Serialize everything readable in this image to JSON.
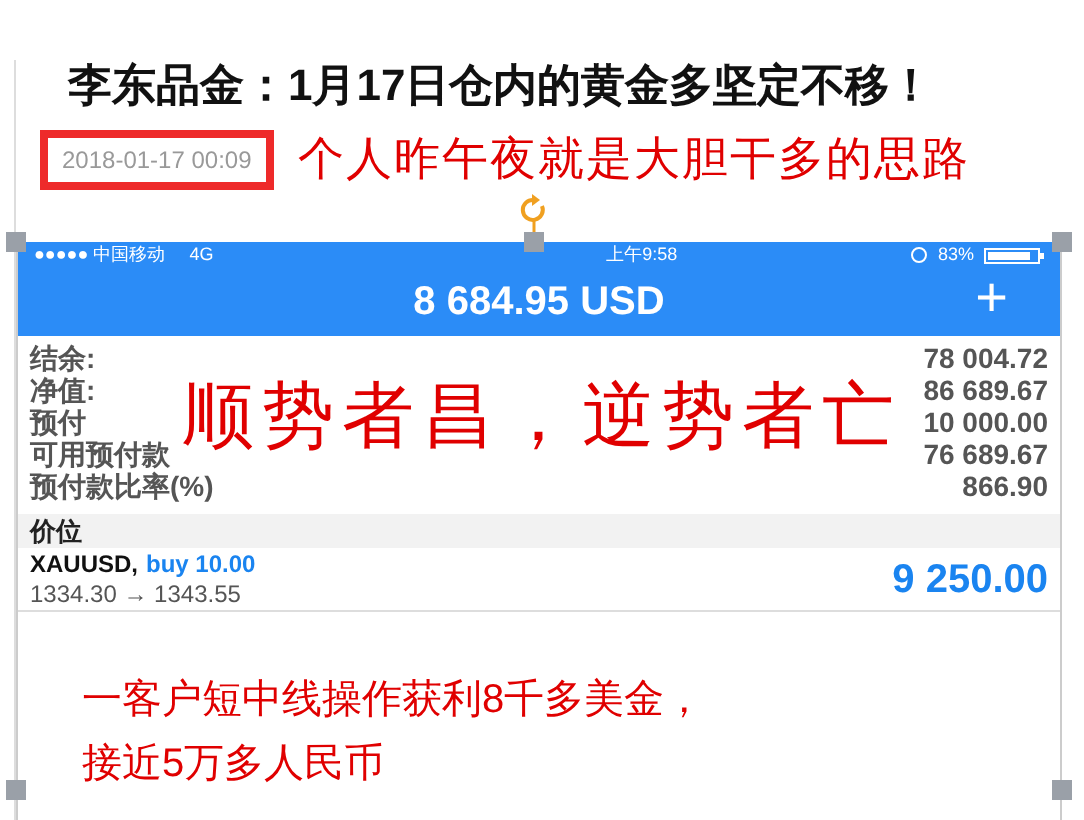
{
  "article": {
    "title": "李东品金：1月17日仓内的黄金多坚定不移！",
    "date": "2018-01-17 00:09",
    "note": "个人昨午夜就是大胆干多的思路"
  },
  "screenshot": {
    "status_bar": {
      "carrier": "●●●●● 中国移动",
      "network": "4G",
      "time": "上午9:58",
      "battery": "83%"
    },
    "header": {
      "balance": "8 684.95 USD",
      "add": "+"
    },
    "account_rows": [
      {
        "label": "结余:",
        "value": "78 004.72"
      },
      {
        "label": "净值:",
        "value": "86 689.67"
      },
      {
        "label": "预付",
        "value": "10 000.00"
      },
      {
        "label": "可用预付款",
        "value": "76 689.67"
      },
      {
        "label": "预付款比率(%)",
        "value": "866.90"
      }
    ],
    "section": "价位",
    "position": {
      "symbol": "XAUUSD,",
      "order": "buy 10.00",
      "prices": "1334.30 → 1343.55",
      "profit": "9 250.00"
    },
    "overlay": "顺势者昌，逆势者亡",
    "caption": [
      "一客户短中线操作获利8千多美金，",
      "接近5万多人民币"
    ]
  }
}
